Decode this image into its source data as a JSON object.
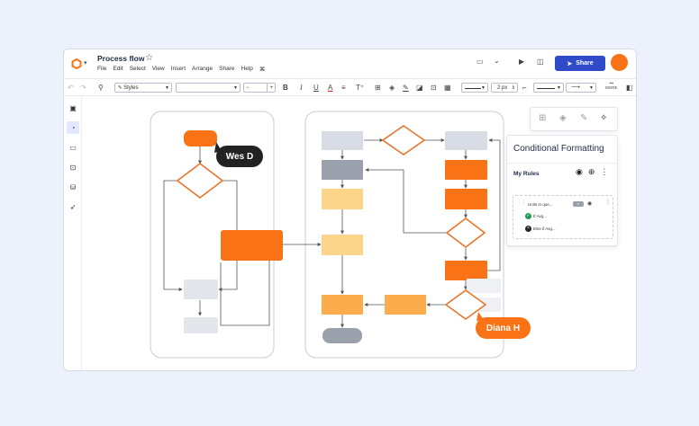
{
  "document": {
    "title": "Process flow"
  },
  "menu": [
    "File",
    "Edit",
    "Select",
    "View",
    "Insert",
    "Arrange",
    "Share",
    "Help"
  ],
  "header": {
    "share_label": "Share"
  },
  "toolbar": {
    "style_select": "Styles",
    "font_size_minus": "−",
    "font_size_plus": "+",
    "bold": "B",
    "italic": "I",
    "underline": "U",
    "text_color": "A",
    "line_width": "2 px",
    "more_label": "MORE"
  },
  "panel": {
    "title": "Conditional Formatting",
    "my_rules_label": "My Rules",
    "rule": {
      "name": "Units in que...",
      "conditions": [
        "If Avg...",
        "Else if Avg..."
      ]
    }
  },
  "collaborators": [
    {
      "name": "Wes D",
      "color": "#222222"
    },
    {
      "name": "Diana H",
      "color": "#f97316"
    }
  ],
  "colors": {
    "accent": "#f97316",
    "brand": "#2f4bc9",
    "light_orange": "#fdd58a",
    "mid_orange": "#fbad4e",
    "gray_shape": "#d8dce4",
    "dark_gray_shape": "#9aa1ad"
  },
  "icons": {
    "logo": "lucid-logo-icon",
    "star": "star-icon",
    "present": "present-icon",
    "video": "video-camera-icon",
    "comment": "comment-icon"
  }
}
